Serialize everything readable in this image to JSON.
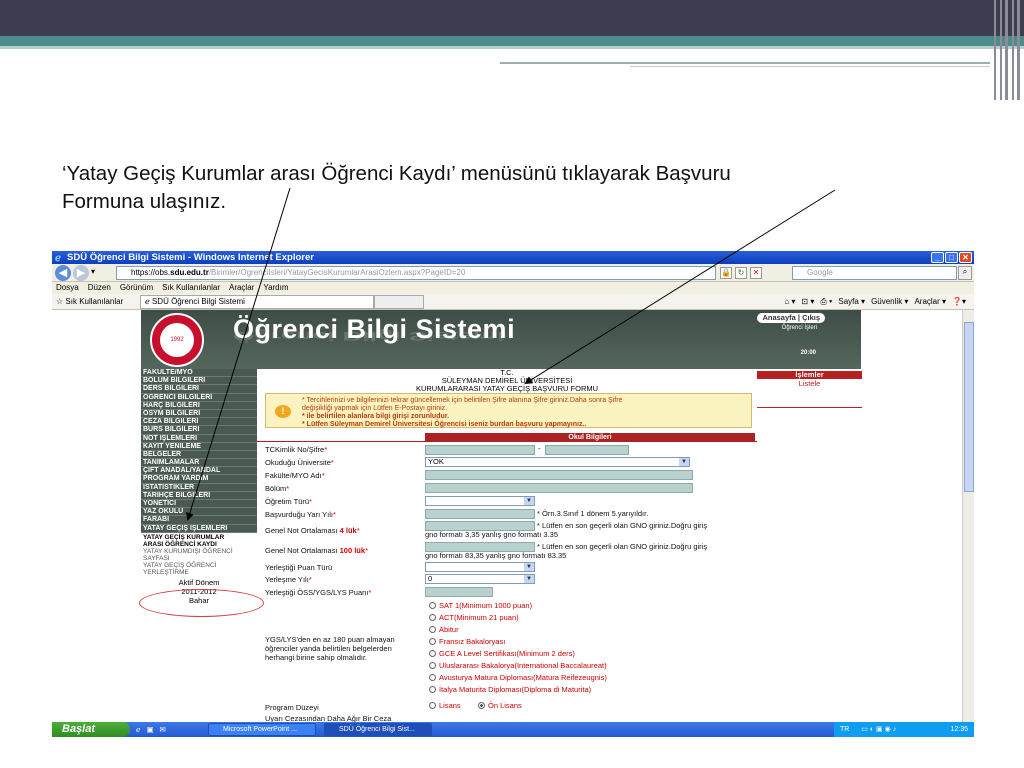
{
  "slide": {
    "caption_line1": "‘Yatay Geçiş Kurumlar arası Öğrenci Kaydı’ menüsünü tıklayarak Başvuru",
    "caption_line2": "Formuna ulaşınız."
  },
  "browser": {
    "title": "SDÜ Öğrenci Bilgi Sistemi - Windows Internet Explorer",
    "address_prefix": "https://obs.",
    "address_domain": "sdu.edu.tr",
    "address_rest": "/Birimler/OgrenciIsleri/YatayGecisKurumlarArasiOzlem.aspx?PageID=20",
    "search_placeholder": "Google",
    "menu": [
      "Dosya",
      "Düzen",
      "Görünüm",
      "Sık Kullanılanlar",
      "Araçlar",
      "Yardım"
    ],
    "favorites_label": "Sık Kullanılanlar",
    "tab_label": "SDÜ Öğrenci Bilgi Sistemi",
    "commands": [
      "Sayfa ▾",
      "Güvenlik ▾",
      "Araçlar ▾"
    ]
  },
  "site": {
    "banner_title": "Öğrenci Bilgi Sistemi",
    "logo_text": "SÜLEYMAN DEMİREL",
    "logo_year": "1992",
    "top_links": "Anasayfa | Çıkış",
    "top_sub": "Öğrenci İşleri",
    "clock": "20:00"
  },
  "sidebar": {
    "items": [
      "FAKÜLTE/MYO",
      "BÖLÜM BİLGİLERİ",
      "DERS BİLGİLERİ",
      "ÖĞRENCİ BİLGİLERİ",
      "HARÇ BİLGİLERİ",
      "ÖSYM BİLGİLERİ",
      "CEZA BİLGİLERİ",
      "BURS BİLGİLERİ",
      "NOT İŞLEMLERİ",
      "KAYIT YENİLEME",
      "BELGELER",
      "TANIMLAMALAR",
      "ÇİFT ANADAL/YANDAL",
      "PROGRAM YARDIM",
      "İSTATİSTİKLER",
      "TARİHÇE BİLGİLERİ",
      "YÖNETİCİ",
      "YAZ OKULU",
      "FARABİ",
      "YATAY GEÇİŞ İŞLEMLERİ"
    ],
    "sub_items": [
      "YATAY GEÇİŞ KURUMLAR",
      "ARASI ÖĞRENCİ KAYDI",
      "YATAY KURUMDIŞI ÖĞRENCİ",
      "SAYFASI",
      "YATAY GEÇİŞ ÖĞRENCİ",
      "YERLEŞTİRME"
    ],
    "term_label": "Aktif Dönem",
    "term_year": "2011-2012",
    "term_season": "Bahar"
  },
  "form": {
    "header_line1": "T.C.",
    "header_line2": "SÜLEYMAN DEMİREL ÜNİVERSİTESİ",
    "header_line3": "KURUMLARARASI YATAY GEÇİŞ BAŞVURU FORMU",
    "warning_line1": "* Tercihlerinizi ve bilgilerinizi tekrar güncellemek için belirtilen Şifre alanına Şifre giriniz.Daha sonra Şifre",
    "warning_line2": "değişikliği yapmak için Lütfen E-Postayı giriniz.",
    "warning_line3": "* ile belirtilen alanlara bilgi girişi zorunludur.",
    "warning_line4": "* Lütfen Süleyman Demirel Üniversitesi Öğrencisi iseniz burdan başvuru yapmayınız..",
    "section_title": "Okul Bilgileri",
    "labels": {
      "tckimlik": "TCKimlik No/Şifre",
      "universite": "Okuduğu Üniversite",
      "fakulte": "Fakülte/MYO Adı",
      "bolum": "Bölüm",
      "ogretim": "Öğretim Türü",
      "yaryil": "Başvurduğu Yarı Yılı",
      "gno4": "Genel Not Ortalaması ",
      "gno4_strong": "4 lük",
      "gno100": "Genel Not Ortalaması ",
      "gno100_strong": "100 lük",
      "puanturu": "Yerleştiği Puan Türü",
      "yerlesmeyili": "Yerleşme Yılı",
      "osspuan": "Yerleştiği ÖSS/YGS/LYS Puanı",
      "ygs_line1": "YGS/LYS'den en az 180 puan almayan",
      "ygs_line2": "öğrenciler yanda belirtilen belgelerden",
      "ygs_line3": "herhangi birine sahip olmalıdır.",
      "program": "Program Düzeyi",
      "ceza": "Uyarı Cezasından Daha Ağır Bir Ceza"
    },
    "star": "*",
    "dash": "-",
    "universite_value": "YOK",
    "yerlesme_value": "0",
    "yaryil_note": "* Örn.3.Sınıf 1 dönem 5.yarıyıldır.",
    "gno4_note1": "* Lütfen en son geçerli olan GNO giriniz.Doğru giriş",
    "gno4_note2": "gno formatı 3,35 yanlış gno formatı 3.35",
    "gno100_note1": "* Lütfen en son geçerli olan GNO giriniz.Doğru giriş",
    "gno100_note2": "gno formatı 83,35 yanlış gno formatı 83.35",
    "radio_options": [
      "SAT 1(Minimum 1000 puan)",
      "ACT(Minimum 21 puan)",
      "Abitur",
      "Fransız Bakaloryası",
      "GCE A Level Sertifikası(Minimum 2 ders)",
      "Uluslararası Bakalorya(International Baccalaureat)",
      "Avusturya Matura Diploması(Matura Reifezeugnis)",
      "İtalya Maturita Diploması(Diploma di Maturita)"
    ],
    "program_options": [
      "Lisans",
      "Ön Lisans"
    ]
  },
  "side_panel": {
    "header": "İşlemler",
    "link": "Listele"
  },
  "taskbar": {
    "start": "Başlat",
    "task1": "Microsoft PowerPoint ...",
    "task2": "SDÜ Öğrenci Bilgi Sist...",
    "lang": "TR",
    "time": "12:35"
  },
  "colors": {
    "slide_header": "#3c3e4f",
    "slide_band": "#4e8b8b",
    "banner": "#4a5a52",
    "accent_red": "#b52020",
    "warning_bg": "#fbf3c0",
    "input_bg": "#b8d2cf",
    "xp_blue": "#245ad2"
  }
}
